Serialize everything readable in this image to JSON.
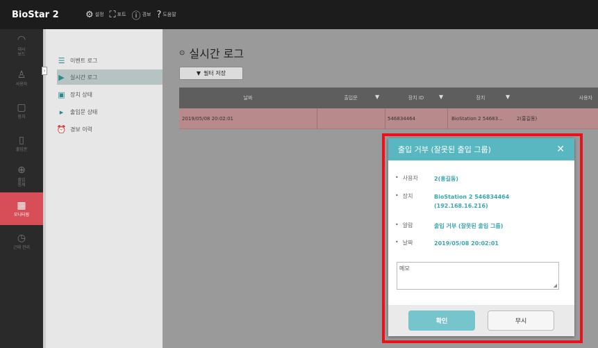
{
  "app": {
    "title": "BioStar 2"
  },
  "topmenu": [
    {
      "icon": "gear-icon",
      "glyph": "⚙",
      "label": "설정"
    },
    {
      "icon": "network-icon",
      "glyph": "⛶",
      "label": "포트"
    },
    {
      "icon": "alert-icon",
      "glyph": "ⓘ",
      "label": "경보"
    },
    {
      "icon": "help-icon",
      "glyph": "?",
      "label": "도움말"
    }
  ],
  "leftnav": [
    {
      "glyph": "◠",
      "label": "대시\n보드"
    },
    {
      "glyph": "♙",
      "label": "사용자"
    },
    {
      "glyph": "▢",
      "label": "장치"
    },
    {
      "glyph": "▯",
      "label": "출입문"
    },
    {
      "glyph": "⊕",
      "label": "출입\n통제"
    },
    {
      "glyph": "▦",
      "label": "모니터링"
    },
    {
      "glyph": "◷",
      "label": "근태 관리"
    }
  ],
  "submenu": [
    {
      "glyph": "☰",
      "label": "이벤트 로그"
    },
    {
      "glyph": "▶",
      "label": "실시간 로그"
    },
    {
      "glyph": "▣",
      "label": "장치 상태"
    },
    {
      "glyph": "▸",
      "label": "출입문 상태"
    },
    {
      "glyph": "⏰",
      "label": "경보 이력"
    }
  ],
  "main": {
    "title": "실시간 로그",
    "filter_save": "필터 저장",
    "columns": [
      "날짜",
      "출입문",
      "장치 ID",
      "장치",
      "사용자"
    ],
    "rows": [
      {
        "date": "2019/05/08 20:02:01",
        "door": "",
        "device_id": "546834464",
        "device": "BioStation 2 54683...",
        "user": "2(홍길동)"
      }
    ]
  },
  "modal": {
    "title": "출입 거부 (잘못된 출입 그룹)",
    "user_label": "사용자",
    "user_value": "2(홍길동)",
    "device_label": "장치",
    "device_value_1": "BioStation 2 546834464",
    "device_value_2": "(192.168.16.216)",
    "alarm_label": "알람",
    "alarm_value": "출입 거부 (잘못된 출입 그룹)",
    "date_label": "날짜",
    "date_value": "2019/05/08 20:02:01",
    "memo_placeholder": "메모",
    "ok": "확인",
    "ignore": "무시"
  },
  "colors": {
    "accent": "#58b7c1",
    "active_nav": "#d84e58",
    "highlight": "#e8121c"
  }
}
